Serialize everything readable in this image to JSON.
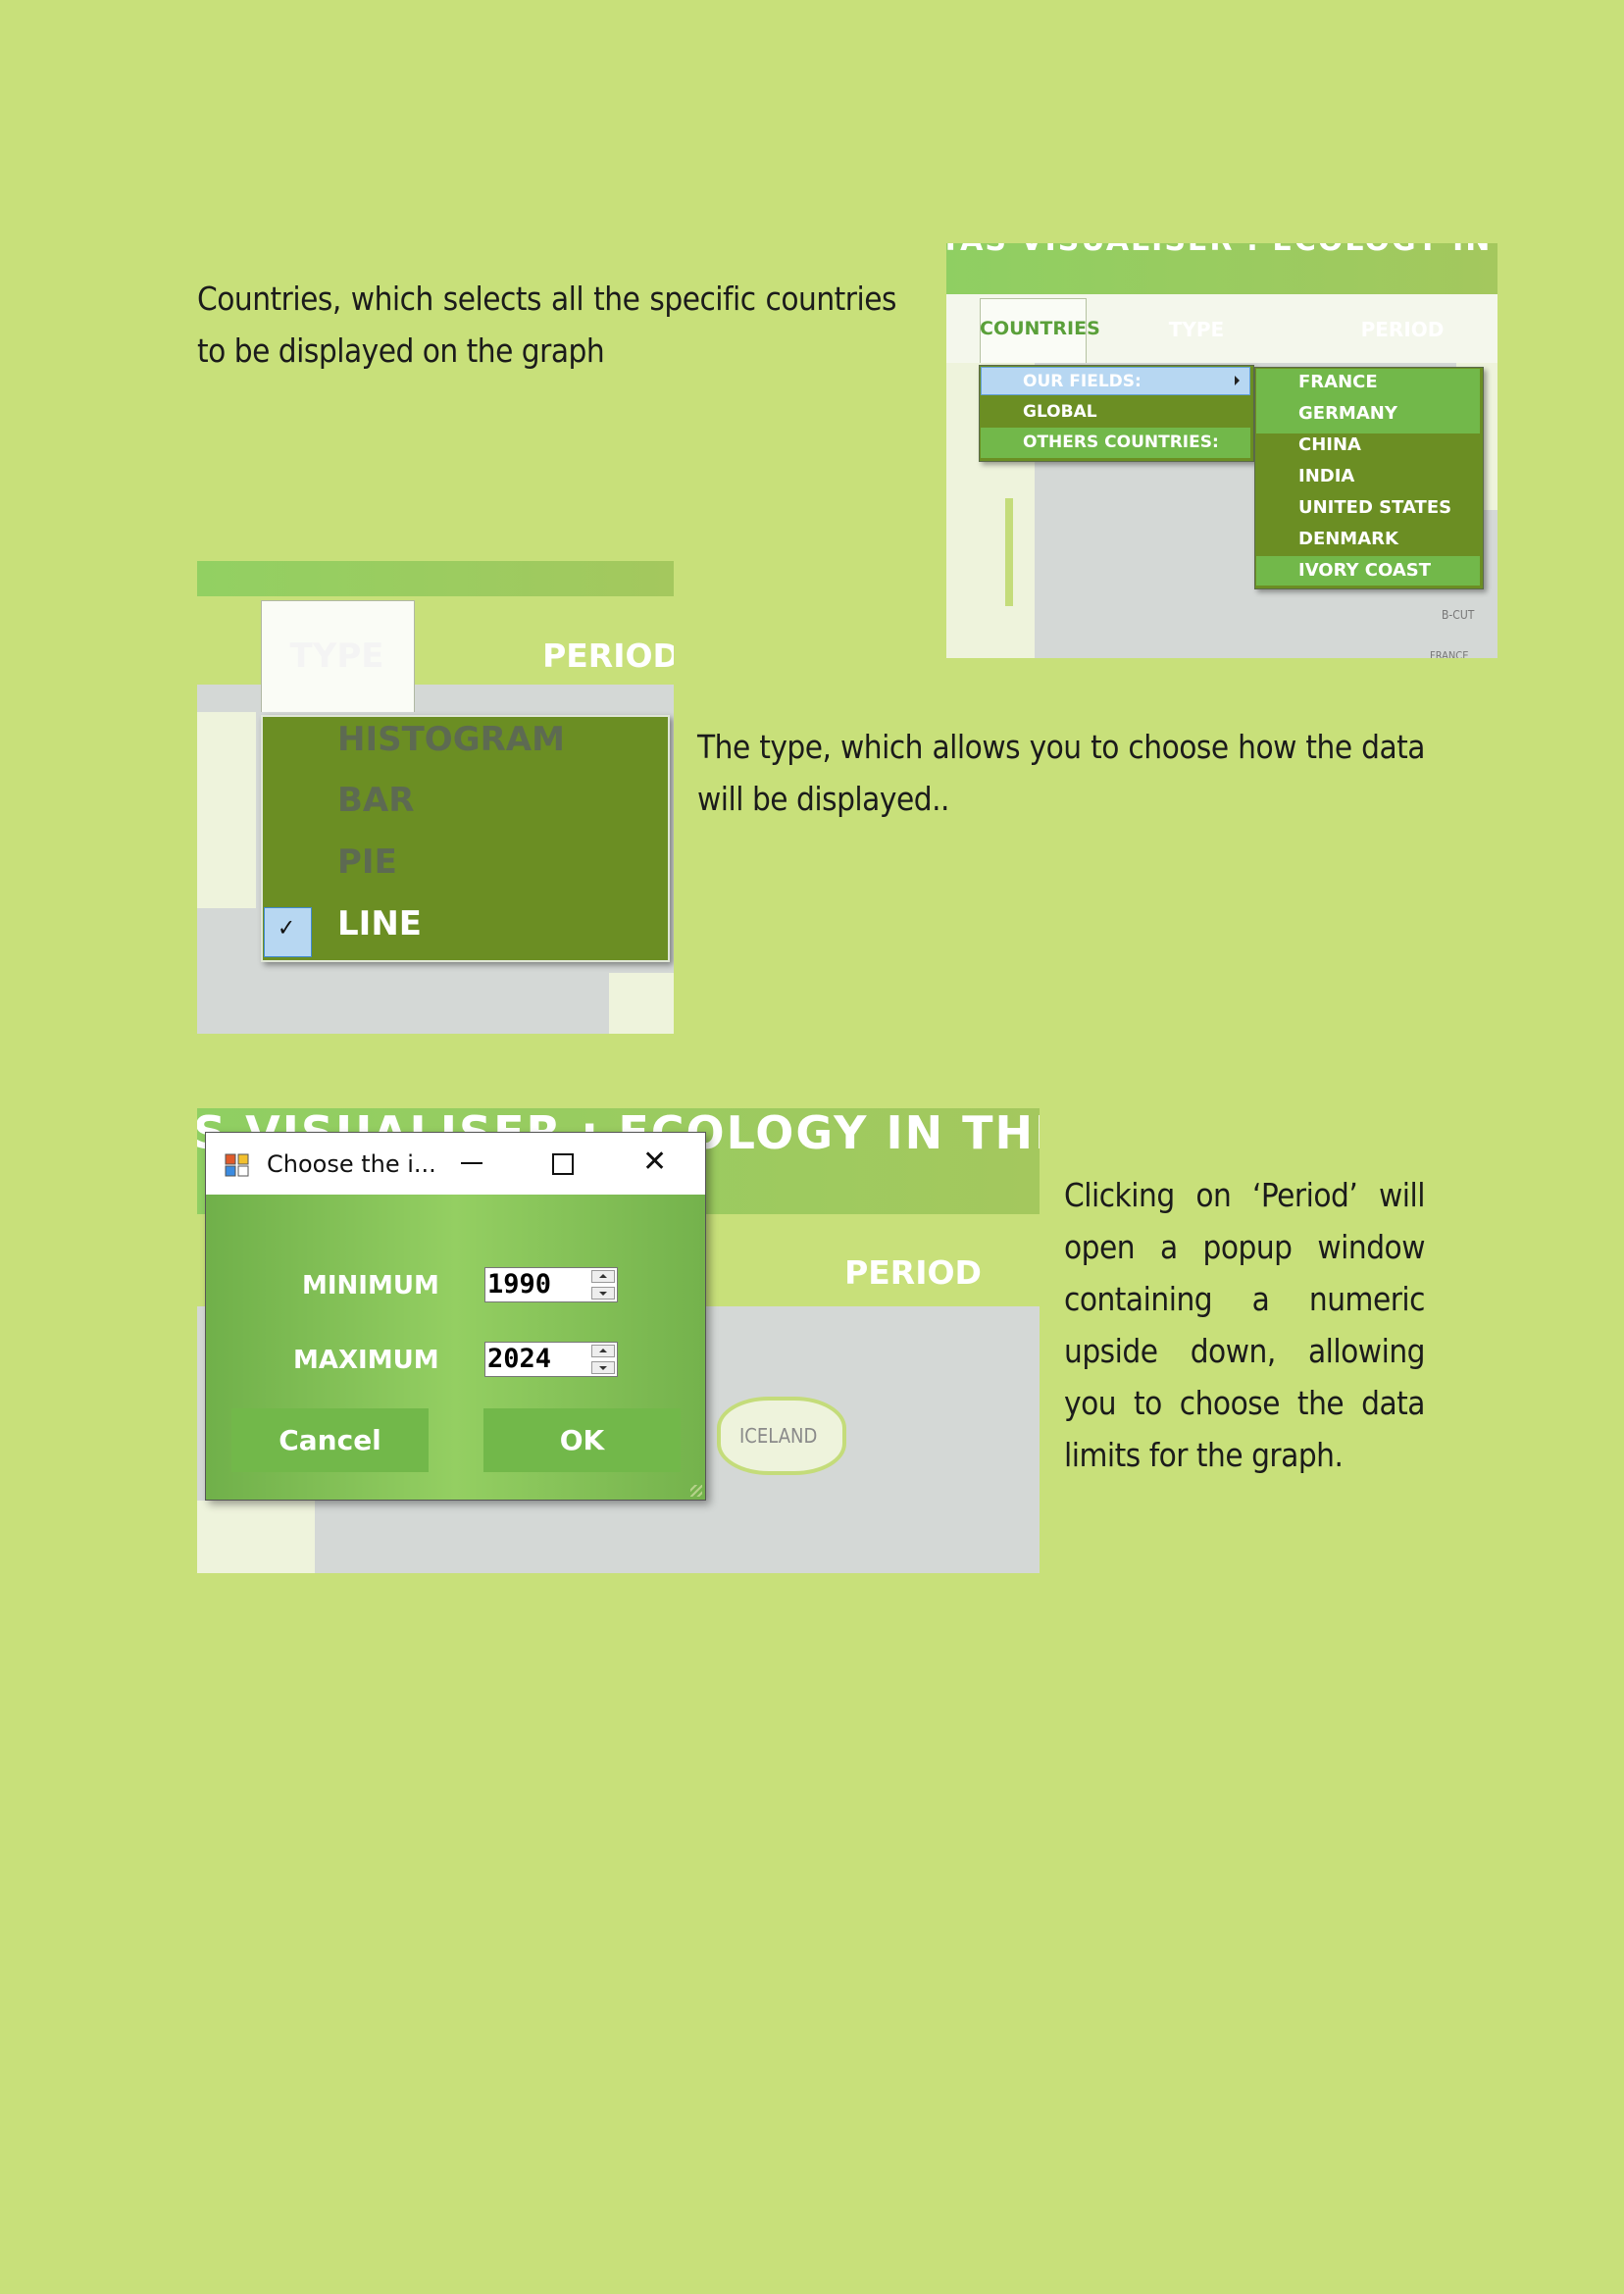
{
  "paragraphs": {
    "countries": "Countries, which selects all the specific countries to be displayed on the graph",
    "type": "The type, which allows you to choose how the data will be displayed..",
    "period": "Clicking on ‘Period’ will open a popup window containing a numeric upside down, allowing you to choose the data limits for the graph."
  },
  "shot1": {
    "banner": "TAS VISUALISER : ECOLOGY IN THE COU",
    "tabs": [
      "COUNTRIES",
      "TYPE",
      "PERIOD"
    ],
    "menu": [
      "OUR FIELDS:",
      "GLOBAL",
      "OTHERS COUNTRIES:"
    ],
    "submenu": [
      "FRANCE",
      "GERMANY",
      "CHINA",
      "INDIA",
      "UNITED STATES",
      "DENMARK",
      "IVORY COAST"
    ],
    "map_labels": [
      "E",
      "B-CUT",
      "FRANCE"
    ]
  },
  "shot2": {
    "tabs": [
      "TYPE",
      "PERIOD"
    ],
    "menu": [
      "HISTOGRAM",
      "BAR",
      "PIE",
      "LINE"
    ],
    "checked": "LINE"
  },
  "shot3": {
    "banner": "S VISUALISER : ECOLOGY IN THE CO",
    "tab": "PERIOD",
    "map_label": "ICELAND",
    "dialog": {
      "title": "Choose the i...",
      "min_label": "MINIMUM",
      "min_value": "1990",
      "max_label": "MAXIMUM",
      "max_value": "2024",
      "cancel": "Cancel",
      "ok": "OK"
    }
  },
  "colors": {
    "page": "#c8e07a",
    "menu_dark": "#6b8e23",
    "menu_light": "#72b84a",
    "highlight": "#b7d7f2",
    "banner": "#94cf62"
  }
}
